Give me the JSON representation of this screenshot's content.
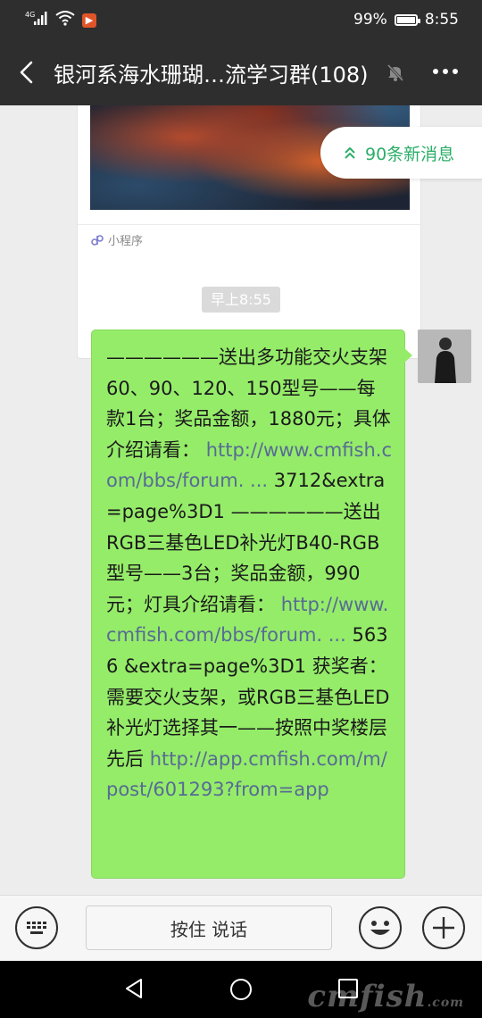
{
  "status_bar": {
    "network": "4G",
    "battery": "99%",
    "battery_level": 0.99,
    "time": "8:55"
  },
  "header": {
    "title": "银河系海水珊瑚…流学习群(108)"
  },
  "mini_program": {
    "label": "小程序"
  },
  "new_messages": {
    "label": "90条新消息"
  },
  "chat": {
    "timestamp": "早上8:55",
    "message": {
      "part1": "——————送出多功能交火支架60、90、120、150型号——每款1台；奖品金额，1880元；具体介绍请看：",
      "link1": "http://www.cmfish.com/bbs/forum. ...",
      "part2": "3712&extra=page%3D1 ——————送出RGB三基色LED补光灯B40-RGB型号——3台；奖品金额，990元；灯具介绍请看：",
      "link2": "http://www.cmfish.com/bbs/forum. ...",
      "part3": "5636 &extra=page%3D1 获奖者：需要交火支架，或RGB三基色LED补光灯选择其一——按照中奖楼层先后",
      "link3": "http://app.cmfish.com/m/post/601293?from=app"
    }
  },
  "input_bar": {
    "hold_to_talk": "按住 说话"
  },
  "watermark": {
    "main": "cmfish",
    "suffix": ".com"
  },
  "colors": {
    "header_bg": "#2e2e2e",
    "bubble_bg": "#95ec69",
    "link": "#576b95",
    "accent_green": "#2aae67"
  }
}
